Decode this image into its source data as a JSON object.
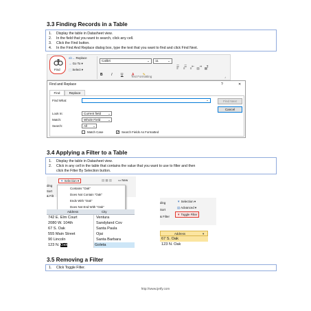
{
  "section33": {
    "heading": "3.3 Finding Records in a Table",
    "steps": [
      {
        "n": "1.",
        "text": "Display the table in Datasheet view."
      },
      {
        "n": "2.",
        "text": "In the field that you want to search, click any cell."
      },
      {
        "n": "3.",
        "text": "Click the Find button."
      },
      {
        "n": "4.",
        "text": "In the Find And Replace dialog box, type the text that you want to find and click Find Next."
      }
    ]
  },
  "ribbon": {
    "find_label": "Find",
    "replace_label": "Replace",
    "goto_label": "Go To ▾",
    "select_label": "Select ▾",
    "font_name": "Calibri",
    "font_size": "11",
    "text_formatting_label": "Text Formatting"
  },
  "dialog": {
    "title": "Find and Replace",
    "help": "?",
    "close": "✕",
    "tab_find": "Find",
    "tab_replace": "Replace",
    "find_what_label": "Find What:",
    "find_next_button": "Find Next",
    "cancel_button": "Cancel",
    "look_in_label": "Look In:",
    "look_in_value": "Current field",
    "match_label": "Match:",
    "match_value": "Whole Field",
    "search_label": "Search:",
    "search_value": "All",
    "match_case_label": "Match Case",
    "search_formatted_label": "Search Fields As Formatted"
  },
  "section34": {
    "heading": "3.4 Applying a Filter to a Table",
    "steps": [
      {
        "n": "1.",
        "text": "Display the table in Datasheet view."
      },
      {
        "n": "2.",
        "text": "Click in any cell in the table that contains the value that you want to use to filter and then"
      },
      {
        "n": "",
        "text": "click the Filter By Selection button."
      }
    ]
  },
  "filter_left": {
    "ding": "ding",
    "sort": "Sort",
    "filt": "& Filt",
    "selection_label": "Selection ▾",
    "new_label": "New",
    "menu_items": [
      "Contains \"Oak\"",
      "Does Not Contain \"Oak\"",
      "Ends With \"Oak\"",
      "Does Not End With \"Oak\""
    ],
    "col_address": "Address",
    "col_city": "City",
    "rows": [
      {
        "address": "742 E. Elm Court",
        "city": "Ventura"
      },
      {
        "address": "2080 W. 104th",
        "city": "Sandyland Cov"
      },
      {
        "address": "67 S. Oak",
        "city": "Santa Paula"
      },
      {
        "address": "555 Main Street",
        "city": "Ojai"
      },
      {
        "address": "90 Lincoln",
        "city": "Santa Barbara"
      }
    ],
    "last_row_prefix": "123 N.",
    "last_row_selected": "Oak",
    "last_row_city": "Goleta"
  },
  "filter_right": {
    "ding": "ding",
    "sort": "Sort",
    "filter": "& Filter",
    "selection_label": "Selection ▾",
    "advanced_label": "Advanced ▾",
    "toggle_label": "Toggle Filter",
    "col_address": "Address",
    "rows": [
      "67 S. Oak",
      "123 N. Oak"
    ]
  },
  "section35": {
    "heading": "3.5 Removing a Filter",
    "steps": [
      {
        "n": "1.",
        "text": "Click Toggle Filter."
      }
    ]
  },
  "footer": {
    "url": "http://www.ijetfy.com"
  },
  "colors": {
    "box_border": "#8faadc",
    "highlight_red": "#e0352b",
    "access_gold": "#fbe5a0",
    "dialog_blue": "#0078d7"
  }
}
